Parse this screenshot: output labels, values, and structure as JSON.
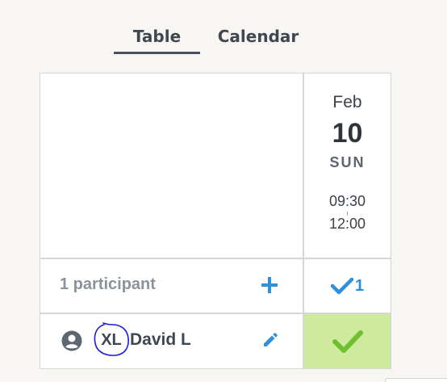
{
  "tabs": {
    "table_label": "Table",
    "calendar_label": "Calendar",
    "active": "Table"
  },
  "date_option": {
    "month": "Feb",
    "day": "10",
    "weekday": "SUN",
    "time_start": "09:30",
    "time_end": "12:00"
  },
  "participants": {
    "count_label": "1 participant",
    "yes_count": "1",
    "rows": [
      {
        "initials": "XL",
        "name": "David L",
        "vote": "yes"
      }
    ]
  },
  "icons": {
    "add": "plus-icon",
    "check": "check-icon",
    "user": "account-circle-icon",
    "edit": "pencil-icon"
  },
  "colors": {
    "accent_blue": "#2f8fd8",
    "yes_cell_bg": "#cdea9e",
    "yes_check": "#6fbf2f",
    "scribble": "#1a1ad6"
  }
}
